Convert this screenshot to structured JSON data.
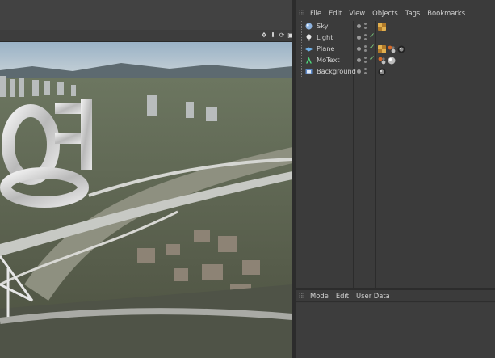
{
  "object_manager": {
    "menu": [
      "File",
      "Edit",
      "View",
      "Objects",
      "Tags",
      "Bookmarks"
    ],
    "objects": [
      {
        "name": "Sky",
        "icon": "sky-icon",
        "checked": false,
        "tags": [
          "texture-tag"
        ]
      },
      {
        "name": "Light",
        "icon": "light-icon",
        "checked": true,
        "tags": []
      },
      {
        "name": "Plane",
        "icon": "plane-icon",
        "checked": true,
        "tags": [
          "texture-tag",
          "material-tag",
          "camera-tag"
        ]
      },
      {
        "name": "MoText",
        "icon": "motext-icon",
        "checked": true,
        "tags": [
          "material-tag",
          "sphere-material-tag"
        ]
      },
      {
        "name": "Background",
        "icon": "background-icon",
        "checked": false,
        "tags": [
          "camera-tag"
        ]
      }
    ]
  },
  "attributes_manager": {
    "menu": [
      "Mode",
      "Edit",
      "User Data"
    ]
  },
  "viewport": {
    "nav_icons": [
      "move-icon",
      "arrow-down-icon",
      "rotate-icon",
      "maximize-icon"
    ]
  },
  "colors": {
    "panel": "#3b3b3b",
    "separator": "#2c2c2c",
    "check": "#7fd27f"
  }
}
